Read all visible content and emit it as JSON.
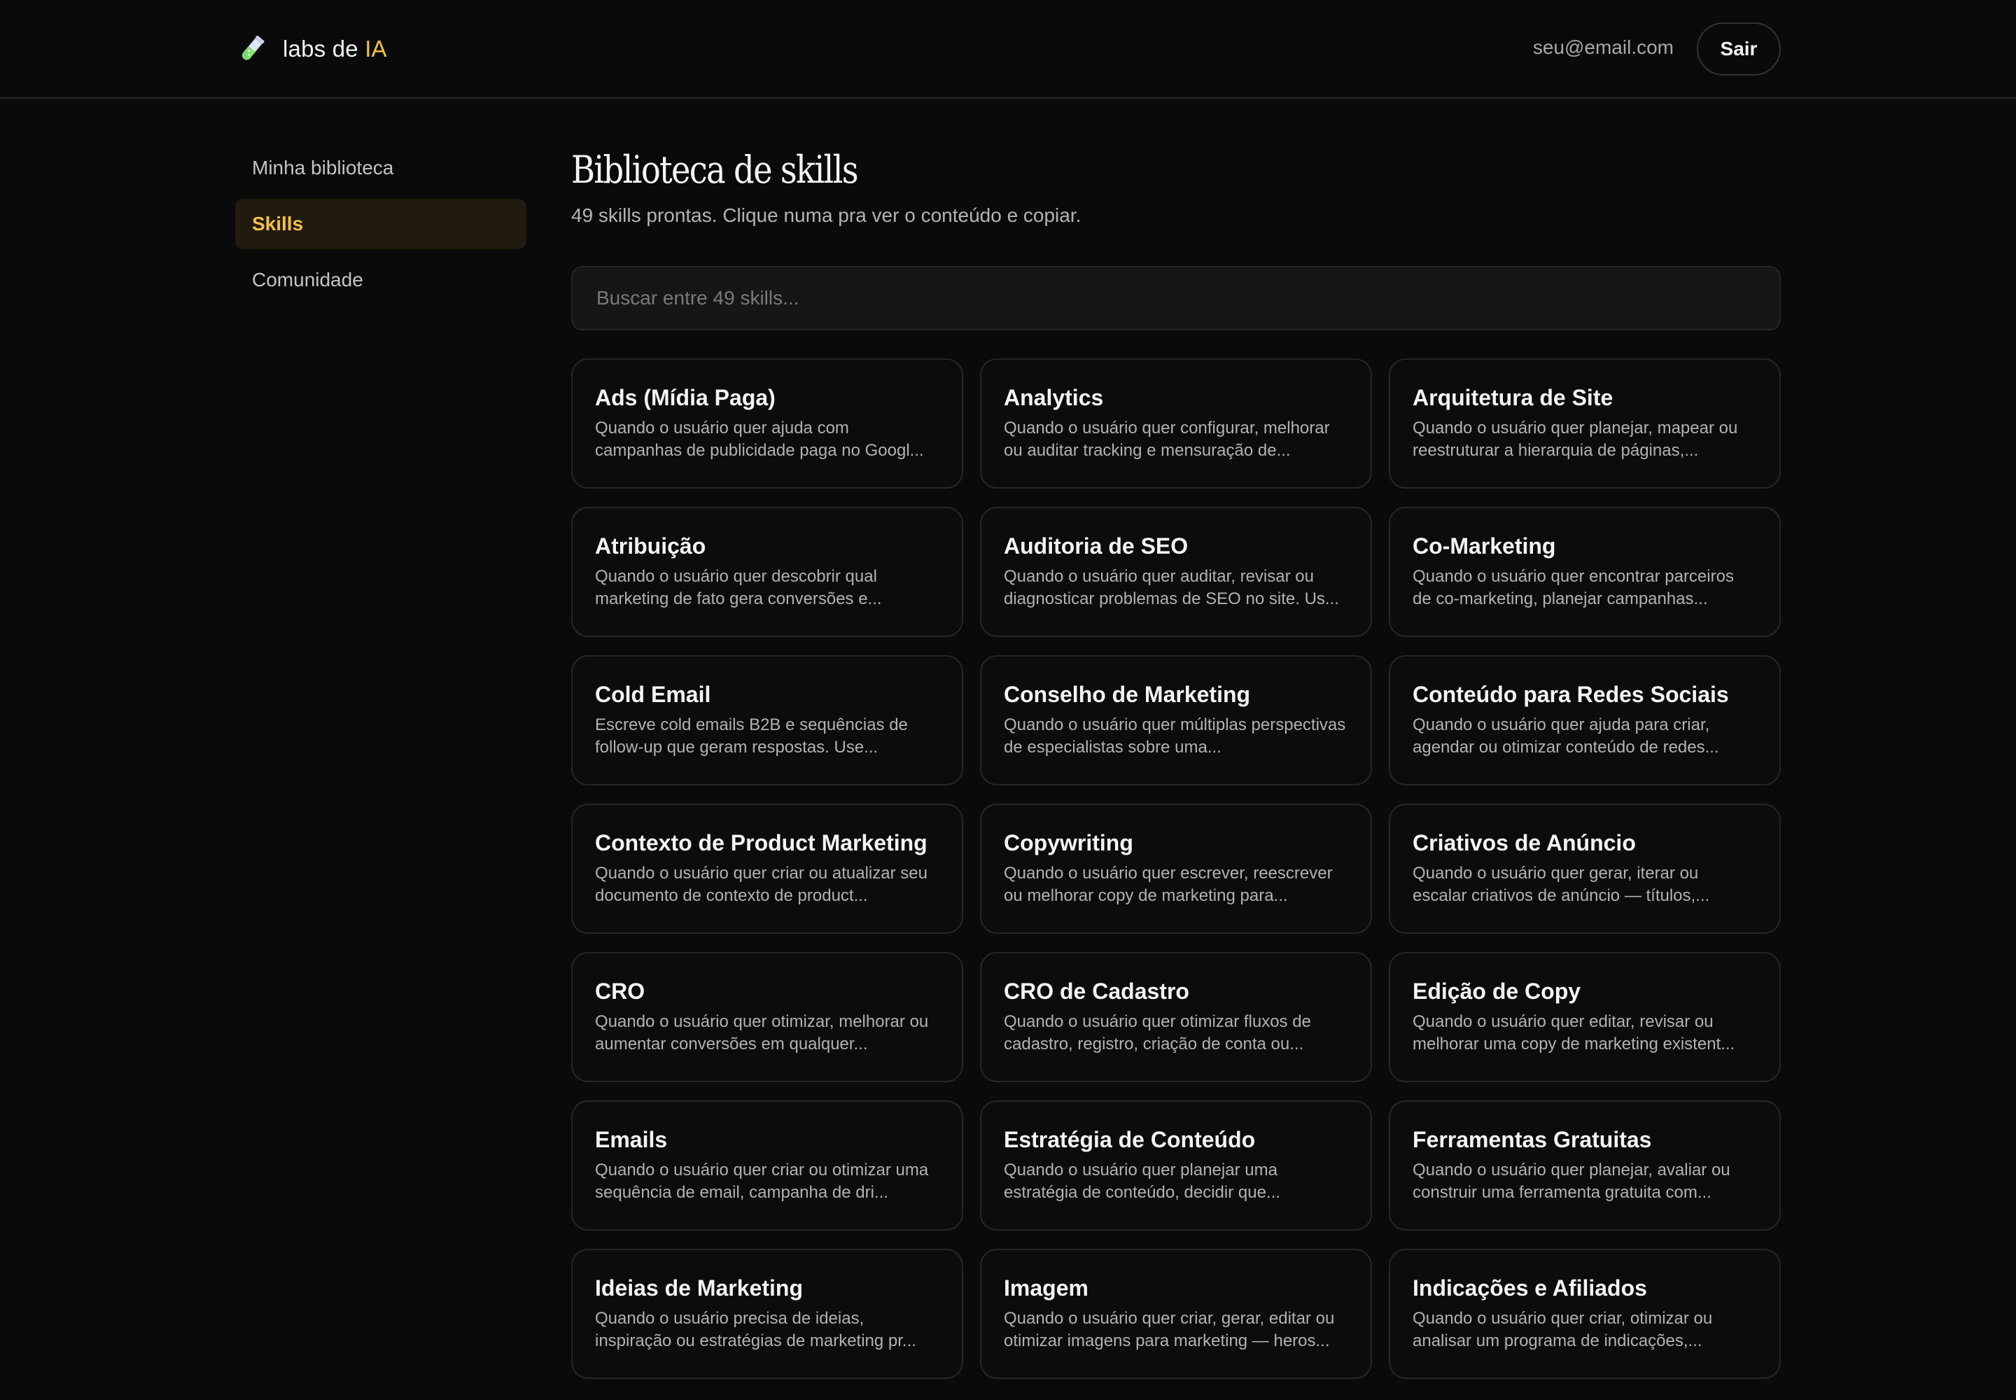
{
  "header": {
    "brand_prefix": "labs de ",
    "brand_accent": "IA",
    "brand_icon": "test-tube-icon",
    "user_email": "seu@email.com",
    "logout_label": "Sair"
  },
  "sidebar": {
    "items": [
      {
        "label": "Minha biblioteca",
        "active": false
      },
      {
        "label": "Skills",
        "active": true
      },
      {
        "label": "Comunidade",
        "active": false
      }
    ]
  },
  "main": {
    "title": "Biblioteca de skills",
    "subtitle": "49 skills prontas. Clique numa pra ver o conteúdo e copiar.",
    "search_placeholder": "Buscar entre 49 skills...",
    "cards": [
      {
        "title": "Ads (Mídia Paga)",
        "desc": "Quando o usuário quer ajuda com campanhas de publicidade paga no Googl..."
      },
      {
        "title": "Analytics",
        "desc": "Quando o usuário quer configurar, melhorar ou auditar tracking e mensuração de..."
      },
      {
        "title": "Arquitetura de Site",
        "desc": "Quando o usuário quer planejar, mapear ou reestruturar a hierarquia de páginas,..."
      },
      {
        "title": "Atribuição",
        "desc": "Quando o usuário quer descobrir qual marketing de fato gera conversões e..."
      },
      {
        "title": "Auditoria de SEO",
        "desc": "Quando o usuário quer auditar, revisar ou diagnosticar problemas de SEO no site. Us..."
      },
      {
        "title": "Co-Marketing",
        "desc": "Quando o usuário quer encontrar parceiros de co-marketing, planejar campanhas..."
      },
      {
        "title": "Cold Email",
        "desc": "Escreve cold emails B2B e sequências de follow-up que geram respostas. Use..."
      },
      {
        "title": "Conselho de Marketing",
        "desc": "Quando o usuário quer múltiplas perspectivas de especialistas sobre uma..."
      },
      {
        "title": "Conteúdo para Redes Sociais",
        "desc": "Quando o usuário quer ajuda para criar, agendar ou otimizar conteúdo de redes..."
      },
      {
        "title": "Contexto de Product Marketing",
        "desc": "Quando o usuário quer criar ou atualizar seu documento de contexto de product..."
      },
      {
        "title": "Copywriting",
        "desc": "Quando o usuário quer escrever, reescrever ou melhorar copy de marketing para..."
      },
      {
        "title": "Criativos de Anúncio",
        "desc": "Quando o usuário quer gerar, iterar ou escalar criativos de anúncio — títulos,..."
      },
      {
        "title": "CRO",
        "desc": "Quando o usuário quer otimizar, melhorar ou aumentar conversões em qualquer..."
      },
      {
        "title": "CRO de Cadastro",
        "desc": "Quando o usuário quer otimizar fluxos de cadastro, registro, criação de conta ou..."
      },
      {
        "title": "Edição de Copy",
        "desc": "Quando o usuário quer editar, revisar ou melhorar uma copy de marketing existent..."
      },
      {
        "title": "Emails",
        "desc": "Quando o usuário quer criar ou otimizar uma sequência de email, campanha de dri..."
      },
      {
        "title": "Estratégia de Conteúdo",
        "desc": "Quando o usuário quer planejar uma estratégia de conteúdo, decidir que..."
      },
      {
        "title": "Ferramentas Gratuitas",
        "desc": "Quando o usuário quer planejar, avaliar ou construir uma ferramenta gratuita com..."
      },
      {
        "title": "Ideias de Marketing",
        "desc": "Quando o usuário precisa de ideias, inspiração ou estratégias de marketing pr..."
      },
      {
        "title": "Imagem",
        "desc": "Quando o usuário quer criar, gerar, editar ou otimizar imagens para marketing — heros..."
      },
      {
        "title": "Indicações e Afiliados",
        "desc": "Quando o usuário quer criar, otimizar ou analisar um programa de indicações,..."
      }
    ]
  },
  "colors": {
    "background": "#0a0a0a",
    "accent": "#f2c04a",
    "active_item_bg": "#211b0f",
    "border": "#262626"
  }
}
